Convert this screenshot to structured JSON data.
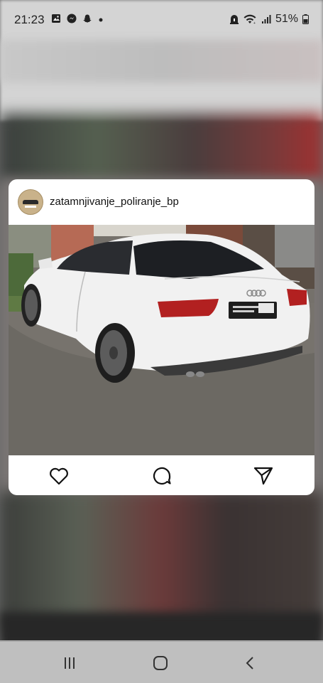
{
  "status_bar": {
    "time": "21:23",
    "battery": "51%",
    "left_icons": [
      "gallery-icon",
      "messenger-icon",
      "snapchat-icon",
      "dot-icon"
    ],
    "right_icons": [
      "alarm-icon",
      "wifi-icon",
      "signal-icon",
      "battery-icon"
    ]
  },
  "post": {
    "username": "zatamnjivanje_poliranje_bp",
    "photo_description_icon": "car-photo",
    "actions": {
      "like_icon": "heart-icon",
      "comment_icon": "comment-icon",
      "share_icon": "send-icon"
    }
  },
  "nav_bar": {
    "icons": [
      "recent-apps-icon",
      "home-icon",
      "back-icon"
    ]
  },
  "colors": {
    "card_bg": "#ffffff",
    "status_text": "#222222",
    "nav_bg": "#bfbfbf",
    "car_white": "#f1f1f1"
  }
}
